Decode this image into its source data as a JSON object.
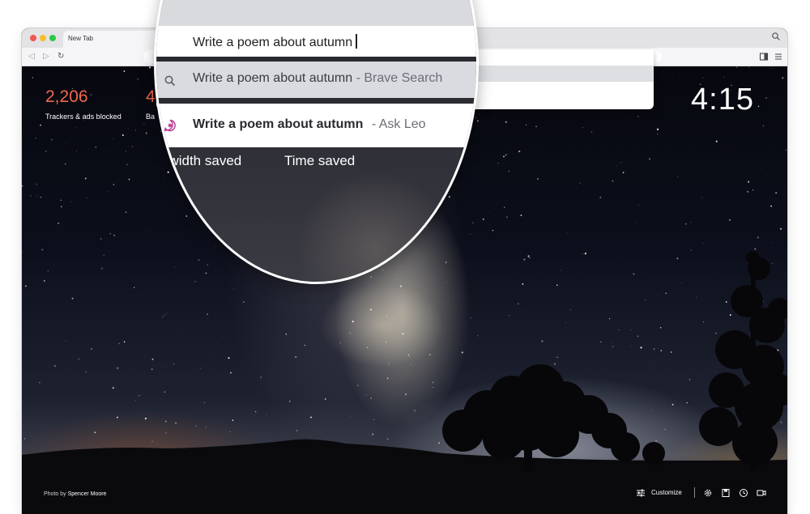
{
  "tab": {
    "title": "New Tab",
    "close": "×"
  },
  "toolbar": {
    "back": "◁",
    "forward": "▷",
    "reload": "↻"
  },
  "stats": {
    "trackers_count": "2,206",
    "trackers_label": "Trackers & ads blocked",
    "bandwidth_count_partial": "4",
    "bandwidth_label_partial": "Ba"
  },
  "clock": "4:15",
  "autocomplete": {
    "query": "Write a poem about autumn",
    "suggestions": [
      {
        "text": "Write a poem about autumn",
        "suffix": "- Brave Search",
        "icon": "search-icon",
        "highlighted": true
      },
      {
        "text": "Write a poem about autumn",
        "suffix": "- Ask Leo",
        "icon": "leo-icon",
        "highlighted": false
      }
    ]
  },
  "lens_stats": {
    "bandwidth_label": "dwidth saved",
    "time_label": "Time saved"
  },
  "footer": {
    "credit_prefix": "Photo by",
    "credit_name": "Spencer Moore",
    "customize_label": "Customize"
  },
  "colors": {
    "stat_accent": "#f2684e",
    "leo_accent": "#b63a93"
  }
}
